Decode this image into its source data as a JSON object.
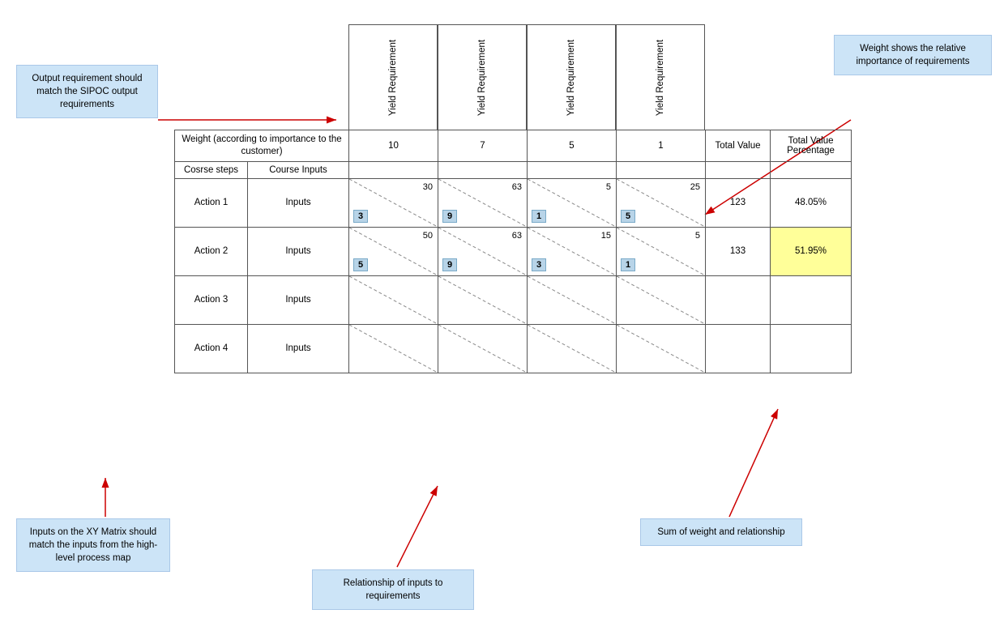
{
  "annotations": {
    "top_left": {
      "text": "Output requirement should match the SIPOC output requirements"
    },
    "top_right": {
      "text": "Weight shows the relative importance of requirements"
    },
    "bottom_left": {
      "text": "Inputs on the XY Matrix should match the inputs from the high-level process map"
    },
    "bottom_mid": {
      "text": "Relationship of inputs to requirements"
    },
    "bottom_right": {
      "text": "Sum of weight and relationship"
    }
  },
  "table": {
    "col_headers": [
      "Yield Requirement",
      "Yield Requirement",
      "Yield Requirement",
      "Yield Requirement"
    ],
    "weight_label": "Weight (according to importance to the customer)",
    "weights": [
      10,
      7,
      5,
      1
    ],
    "total_value_label": "Total Value",
    "total_value_pct_label": "Total Value Percentage",
    "row_header_step": "Cosrse steps",
    "row_header_input": "Course Inputs",
    "rows": [
      {
        "step": "Action 1",
        "input": "Inputs",
        "cells": [
          {
            "top": "30",
            "badge": "3"
          },
          {
            "top": "63",
            "badge": "9"
          },
          {
            "top": "5",
            "badge": "1"
          },
          {
            "top": "25",
            "badge": "5"
          }
        ],
        "total": "123",
        "pct": "48.05%",
        "highlight": false
      },
      {
        "step": "Action 2",
        "input": "Inputs",
        "cells": [
          {
            "top": "50",
            "badge": "5"
          },
          {
            "top": "63",
            "badge": "9"
          },
          {
            "top": "15",
            "badge": "3"
          },
          {
            "top": "5",
            "badge": "1"
          }
        ],
        "total": "133",
        "pct": "51.95%",
        "highlight": true
      },
      {
        "step": "Action 3",
        "input": "Inputs",
        "cells": [
          {
            "top": "",
            "badge": ""
          },
          {
            "top": "",
            "badge": ""
          },
          {
            "top": "",
            "badge": ""
          },
          {
            "top": "",
            "badge": ""
          }
        ],
        "total": "",
        "pct": "",
        "highlight": false
      },
      {
        "step": "Action 4",
        "input": "Inputs",
        "cells": [
          {
            "top": "",
            "badge": ""
          },
          {
            "top": "",
            "badge": ""
          },
          {
            "top": "",
            "badge": ""
          },
          {
            "top": "",
            "badge": ""
          }
        ],
        "total": "",
        "pct": "",
        "highlight": false
      }
    ]
  }
}
